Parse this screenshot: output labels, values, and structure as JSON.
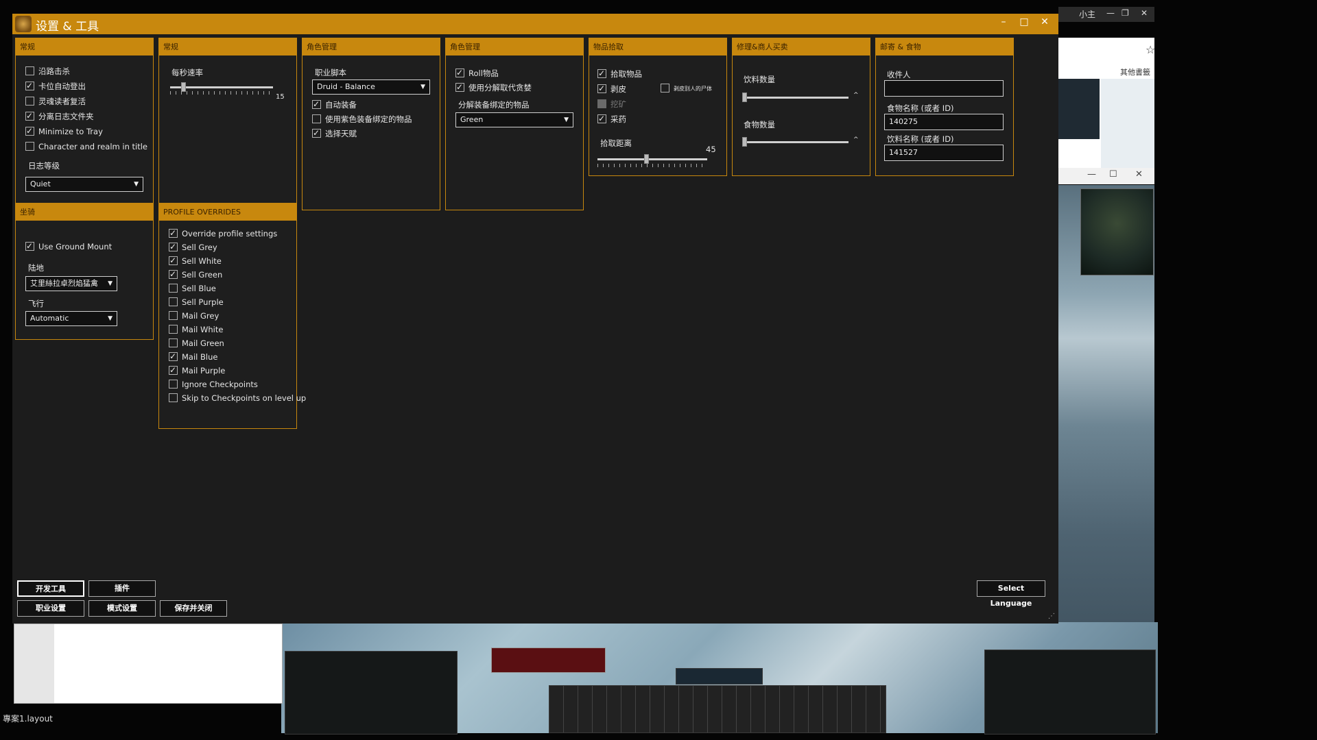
{
  "window": {
    "title": "设置 & 工具"
  },
  "panels": {
    "general": {
      "header": "常规",
      "checkboxes": [
        {
          "label": "沿路击杀",
          "checked": false
        },
        {
          "label": "卡位自动登出",
          "checked": true
        },
        {
          "label": "灵魂读者复活",
          "checked": false
        },
        {
          "label": "分离日志文件夹",
          "checked": true
        },
        {
          "label": "Minimize to Tray",
          "checked": true
        },
        {
          "label": "Character and realm in title",
          "checked": false
        }
      ],
      "log_level_label": "日志等级",
      "log_level_value": "Quiet"
    },
    "general2": {
      "header": "常规",
      "tick_rate_label": "每秒速率",
      "tick_rate_value": "15"
    },
    "role1": {
      "header": "角色管理",
      "class_script_label": "职业脚本",
      "class_script_value": "Druid - Balance",
      "checkboxes": [
        {
          "label": "自动装备",
          "checked": true
        },
        {
          "label": "使用紫色装备绑定的物品",
          "checked": false
        },
        {
          "label": "选择天赋",
          "checked": true
        }
      ]
    },
    "role2": {
      "header": "角色管理",
      "checkboxes": [
        {
          "label": "Roll物品",
          "checked": true
        },
        {
          "label": "使用分解取代贪婪",
          "checked": true
        }
      ],
      "disenchant_label": "分解装备绑定的物品",
      "disenchant_value": "Green"
    },
    "loot": {
      "header": "物品拾取",
      "checkboxes": [
        {
          "label": "拾取物品",
          "checked": true
        },
        {
          "label": "剥皮",
          "checked": true
        },
        {
          "label": "挖矿",
          "checked": false,
          "disabled": true
        },
        {
          "label": "采药",
          "checked": true
        }
      ],
      "extra_checkbox": {
        "label": "剥皮别人的尸体",
        "checked": false
      },
      "loot_range_label": "拾取距离",
      "loot_range_value": "45"
    },
    "repair": {
      "header": "修理&商人买卖",
      "drink_count_label": "饮料数量",
      "food_count_label": "食物数量"
    },
    "mail": {
      "header": "邮寄 & 食物",
      "recipient_label": "收件人",
      "recipient_value": "",
      "food_label": "食物名称 (或者 ID)",
      "food_value": "140275",
      "drink_label": "饮料名称 (或者 ID)",
      "drink_value": "141527"
    },
    "mount": {
      "header": "坐骑",
      "ground_mount": {
        "label": "Use Ground Mount",
        "checked": true
      },
      "ground_label": "陆地",
      "ground_value": "艾里絲拉卓烈焰猛禽",
      "flying_label": "飞行",
      "flying_value": "Automatic"
    },
    "profile": {
      "header": "PROFILE OVERRIDES",
      "checkboxes": [
        {
          "label": "Override profile settings",
          "checked": true
        },
        {
          "label": "Sell Grey",
          "checked": true
        },
        {
          "label": "Sell White",
          "checked": true
        },
        {
          "label": "Sell Green",
          "checked": true
        },
        {
          "label": "Sell Blue",
          "checked": false
        },
        {
          "label": "Sell Purple",
          "checked": false
        },
        {
          "label": "Mail Grey",
          "checked": false
        },
        {
          "label": "Mail White",
          "checked": false
        },
        {
          "label": "Mail Green",
          "checked": false
        },
        {
          "label": "Mail Blue",
          "checked": true
        },
        {
          "label": "Mail Purple",
          "checked": true
        },
        {
          "label": "Ignore Checkpoints",
          "checked": false
        },
        {
          "label": "Skip to Checkpoints on level up",
          "checked": false
        }
      ]
    }
  },
  "buttons": {
    "dev_tools": "开发工具",
    "plugins": "插件",
    "class_settings": "职业设置",
    "mode_settings": "模式设置",
    "save_close": "保存并关闭",
    "select_language": "Select Language"
  },
  "desktop": {
    "layout_label": "專案1.layout",
    "top_right_user": "小主",
    "browser_bookmark": "其他書籤"
  },
  "colors": {
    "accent": "#c8880e",
    "panel_bg": "#1e1e1e",
    "window_bg": "#1c1c1c"
  }
}
